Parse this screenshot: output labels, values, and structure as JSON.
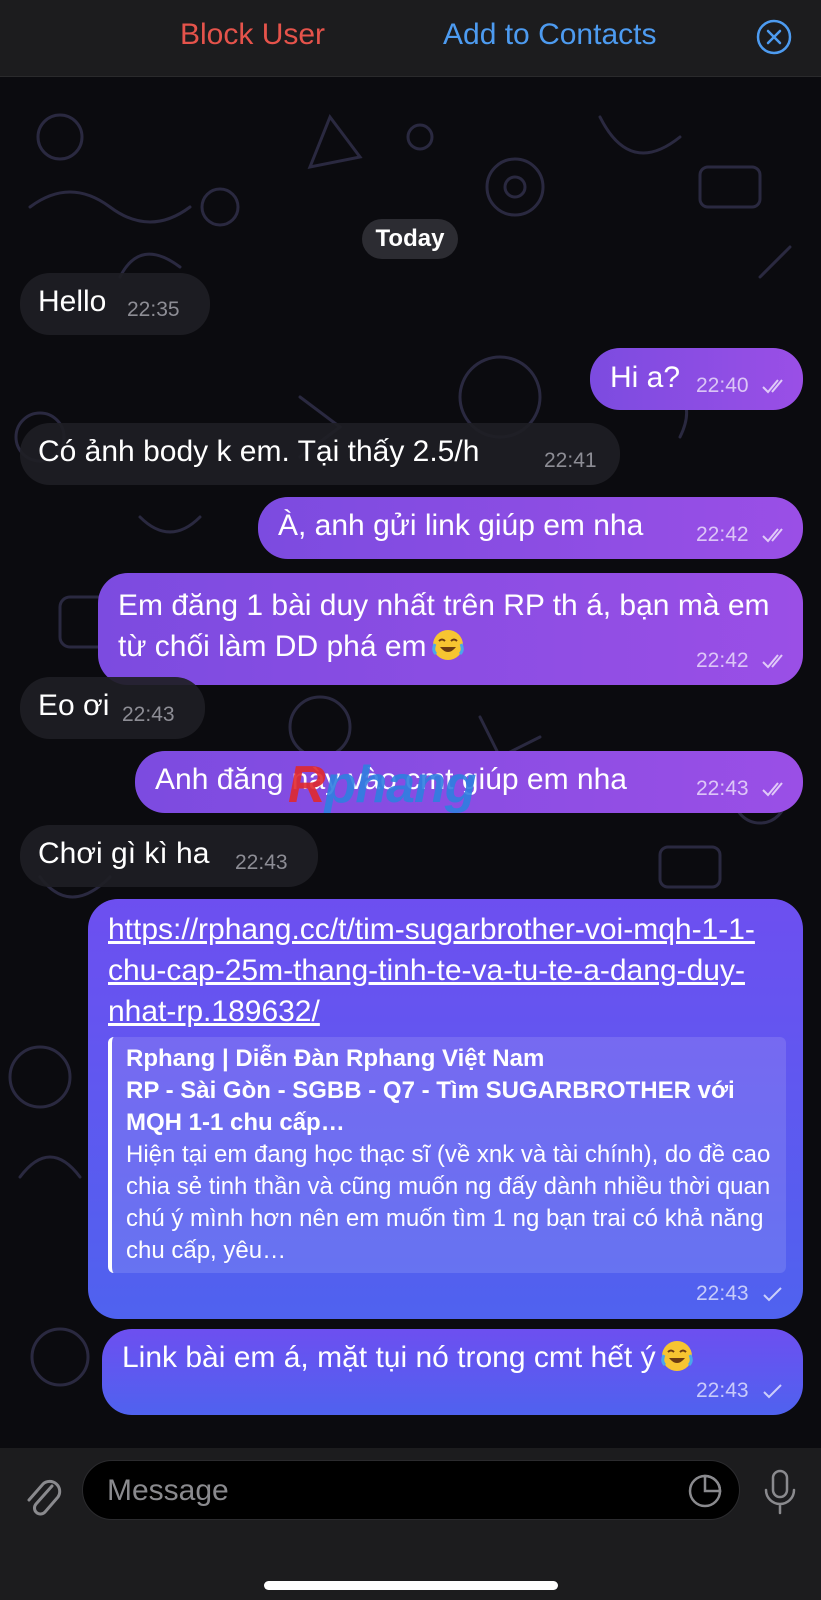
{
  "topbar": {
    "block_user": "Block User",
    "add_to_contacts": "Add to Contacts",
    "close_icon": "close-circle-icon"
  },
  "chat": {
    "date_label": "Today",
    "messages": [
      {
        "dir": "in",
        "text": "Hello",
        "time": "22:35"
      },
      {
        "dir": "out",
        "text": "Hi a?",
        "time": "22:40",
        "status": "read"
      },
      {
        "dir": "in",
        "text": "Có ảnh body k em. Tại thấy 2.5/h",
        "time": "22:41"
      },
      {
        "dir": "out",
        "text": "À, anh gửi link giúp em nha",
        "time": "22:42",
        "status": "read"
      },
      {
        "dir": "out",
        "text": "Em đăng 1 bài duy nhất trên RP th á, bạn mà em từ chối làm DD phá em",
        "emoji": "tears-of-joy",
        "time": "22:42",
        "status": "read"
      },
      {
        "dir": "in",
        "text": "Eo ơi",
        "time": "22:43"
      },
      {
        "dir": "out",
        "text": "Anh đăng này vào cmt giúp em nha",
        "time": "22:43",
        "status": "read"
      },
      {
        "dir": "in",
        "text": "Chơi gì kì ha",
        "time": "22:43"
      },
      {
        "dir": "out",
        "link": "https://rphang.cc/t/tim-sugarbrother-voi-mqh-1-1-chu-cap-25m-thang-tinh-te-va-tu-te-a-dang-duy-nhat-rp.189632/",
        "preview": {
          "site": "Rphang | Diễn Đàn Rphang Việt Nam",
          "title": "RP - Sài Gòn - SGBB - Q7 - Tìm SUGARBROTHER với MQH 1-1 chu cấp…",
          "description": "Hiện tại em đang học thạc sĩ (về xnk và tài chính), do đề cao chia sẻ tinh thần và cũng muốn ng đấy dành nhiều thời quan chú ý mình hơn nên em muốn tìm 1 ng bạn trai có khả năng chu cấp, yêu…"
        },
        "time": "22:43",
        "status": "sent"
      },
      {
        "dir": "out",
        "text": "Link bài em á, mặt tụi nó trong cmt hết ý",
        "emoji": "tears-of-joy",
        "time": "22:43",
        "status": "sent"
      }
    ]
  },
  "watermark": {
    "first": "R",
    "rest": "phang"
  },
  "input": {
    "placeholder": "Message",
    "attach_icon": "paperclip-icon",
    "sticker_icon": "sticker-icon",
    "mic_icon": "microphone-icon"
  },
  "colors": {
    "accent_blue": "#4d9bf0",
    "danger_red": "#e5534b",
    "bubble_purple": "#8a4de4",
    "bubble_blue": "#5a5cf0"
  }
}
